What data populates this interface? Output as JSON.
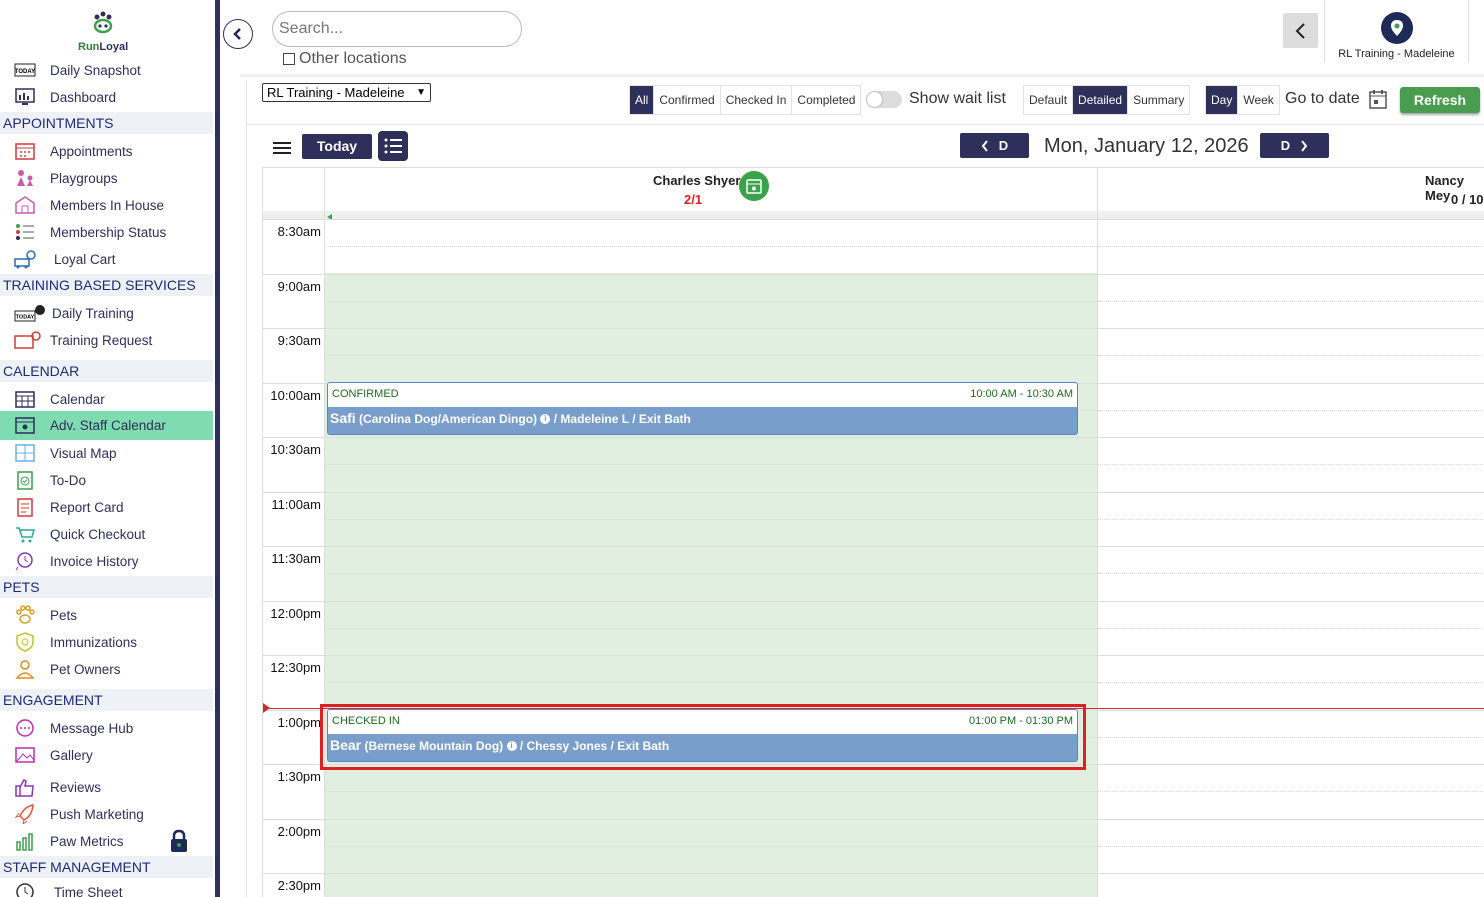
{
  "brand": {
    "name_part1": "Run",
    "name_part2": "Loyal"
  },
  "sidebar": {
    "top_items": [
      {
        "label": "Daily Snapshot",
        "icon": "today-calendar-icon"
      },
      {
        "label": "Dashboard",
        "icon": "dashboard-icon"
      }
    ],
    "sections": [
      {
        "title": "APPOINTMENTS",
        "items": [
          {
            "label": "Appointments",
            "icon": "calendar-grid-icon"
          },
          {
            "label": "Playgroups",
            "icon": "dogs-playing-icon"
          },
          {
            "label": "Members In House",
            "icon": "house-icon"
          },
          {
            "label": "Membership Status",
            "icon": "member-list-icon"
          },
          {
            "label": "Loyal Cart",
            "icon": "cart-icon"
          }
        ]
      },
      {
        "title": "TRAINING BASED SERVICES",
        "items": [
          {
            "label": "Daily Training",
            "icon": "today-whistle-icon"
          },
          {
            "label": "Training Request",
            "icon": "training-request-icon"
          }
        ]
      },
      {
        "title": "CALENDAR",
        "items": [
          {
            "label": "Calendar",
            "icon": "calendar-icon"
          },
          {
            "label": "Adv. Staff Calendar",
            "icon": "staff-calendar-icon",
            "active": true
          },
          {
            "label": "Visual Map",
            "icon": "map-grid-icon"
          },
          {
            "label": "To-Do",
            "icon": "todo-icon"
          },
          {
            "label": "Report Card",
            "icon": "report-card-icon"
          },
          {
            "label": "Quick Checkout",
            "icon": "quick-cart-icon"
          },
          {
            "label": "Invoice History",
            "icon": "invoice-history-icon"
          }
        ]
      },
      {
        "title": "PETS",
        "items": [
          {
            "label": "Pets",
            "icon": "paw-icon"
          },
          {
            "label": "Immunizations",
            "icon": "shield-icon"
          },
          {
            "label": "Pet Owners",
            "icon": "person-icon"
          }
        ]
      },
      {
        "title": "ENGAGEMENT",
        "items": [
          {
            "label": "Message Hub",
            "icon": "chat-icon"
          },
          {
            "label": "Gallery",
            "icon": "gallery-icon"
          },
          {
            "label": "Reviews",
            "icon": "thumbs-up-icon"
          },
          {
            "label": "Push Marketing",
            "icon": "rocket-icon"
          },
          {
            "label": "Paw Metrics",
            "icon": "bar-chart-icon",
            "locked": true
          }
        ]
      },
      {
        "title": "STAFF MANAGEMENT",
        "items": [
          {
            "label": "Time Sheet",
            "icon": "clock-icon"
          }
        ]
      }
    ]
  },
  "topbar": {
    "search_placeholder": "Search...",
    "other_locations_label": "Other locations",
    "location_badge": "RL Training - Madeleine"
  },
  "toolbar": {
    "location_select": "RL Training - Madeleine",
    "status_filters": [
      "All",
      "Confirmed",
      "Checked In",
      "Completed"
    ],
    "status_selected": "All",
    "wait_list_label": "Show wait list",
    "view_modes": [
      "Default",
      "Detailed",
      "Summary"
    ],
    "view_selected": "Detailed",
    "range_modes": [
      "Day",
      "Week"
    ],
    "range_selected": "Day",
    "goto_label": "Go to date",
    "refresh_label": "Refresh"
  },
  "calendar": {
    "today_label": "Today",
    "prev_label": "D",
    "next_label": "D",
    "date_title": "Mon, January 12, 2026",
    "staff": [
      {
        "name": "Charles Shyer",
        "count": "2/1",
        "count_color": "#e02020"
      },
      {
        "name": "Nancy Mey",
        "count": "0 / 10",
        "count_color": "#222222"
      }
    ],
    "times": [
      "8:30am",
      "9:00am",
      "9:30am",
      "10:00am",
      "10:30am",
      "11:00am",
      "11:30am",
      "12:00pm",
      "12:30pm",
      "1:00pm",
      "1:30pm",
      "2:00pm",
      "2:30pm"
    ],
    "appointments": [
      {
        "status": "CONFIRMED",
        "time": "10:00 AM - 10:30 AM",
        "pet": "Safi",
        "breed": "(Carolina Dog/American Dingo)",
        "details": "/ Madeleine L / Exit Bath"
      },
      {
        "status": "CHECKED IN",
        "time": "01:00 PM - 01:30 PM",
        "pet": "Bear",
        "breed": "(Bernese Mountain Dog)",
        "details": "/ Chessy Jones / Exit Bath"
      }
    ]
  },
  "colors": {
    "accent": "#2e2f5b",
    "active_nav": "#7fdcb0",
    "refresh": "#4a9d4f",
    "appointment": "#7a9ecb",
    "available_bg": "#e1efe0"
  }
}
